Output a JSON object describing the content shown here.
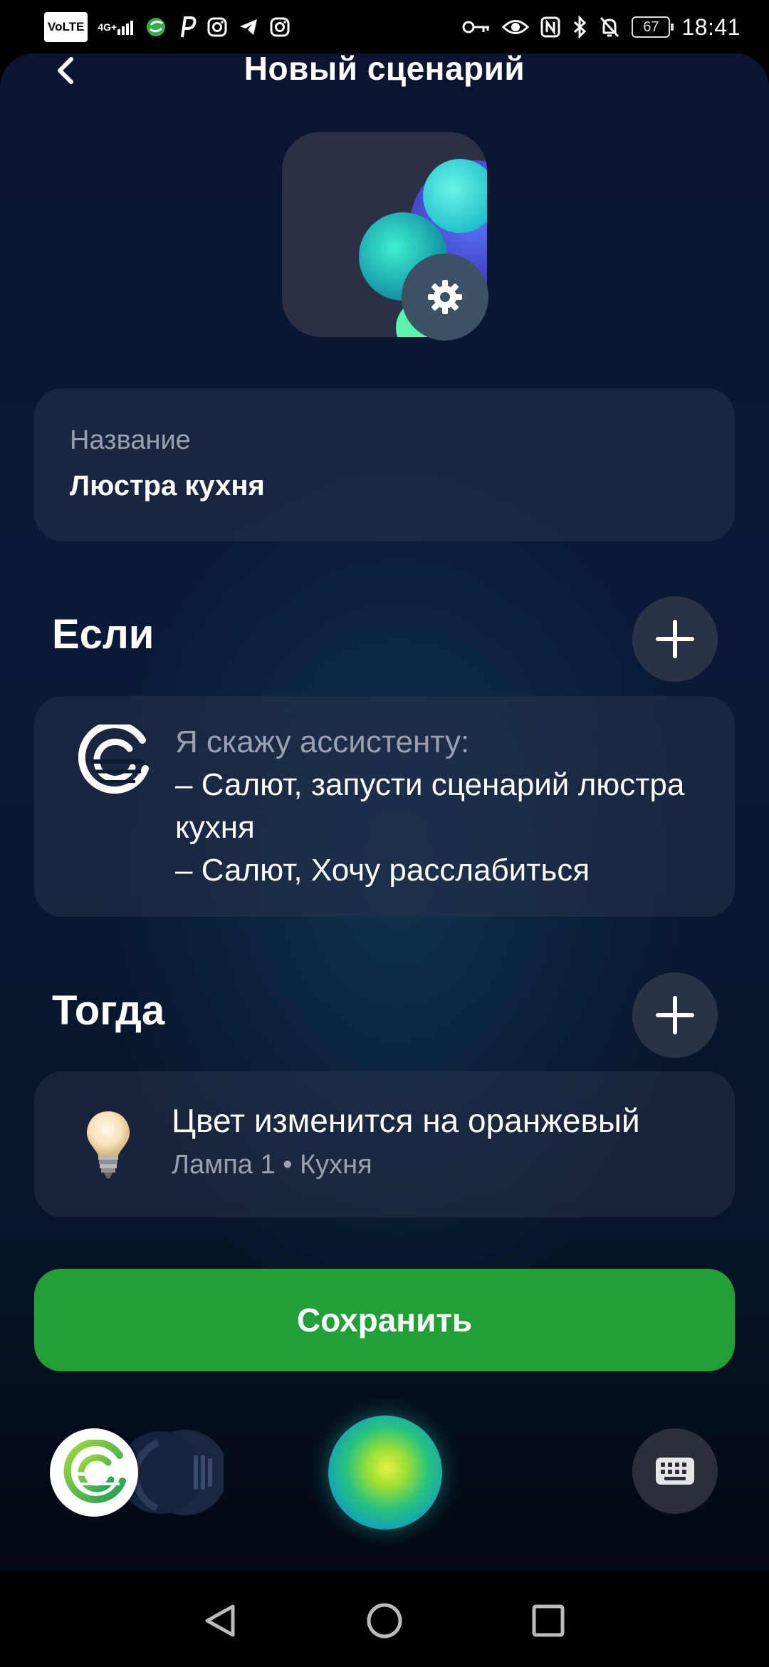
{
  "status_bar": {
    "left_icons": [
      "volte-icon",
      "signal-4g-icon",
      "salute-app-icon",
      "p-app-icon",
      "instagram-icon",
      "telegram-icon",
      "instagram-icon"
    ],
    "volte_label": "VoLTE",
    "network_label": "4G+",
    "right_icons": [
      "key-icon",
      "eye-icon",
      "nfc-icon",
      "bluetooth-icon",
      "mute-icon"
    ],
    "battery": "67",
    "time": "18:41"
  },
  "header": {
    "title": "Новый сценарий",
    "back_icon": "chevron-left-icon"
  },
  "cover": {
    "settings_icon": "gear-icon"
  },
  "name_field": {
    "label": "Название",
    "value": "Люстра кухня"
  },
  "if_section": {
    "title": "Если",
    "add_icon": "plus-icon",
    "condition": {
      "icon": "salute-logo-icon",
      "heading": "Я скажу ассистенту:",
      "phrases": [
        "– Салют, запусти сценарий люстра кухня",
        "– Салют, Хочу расслабиться"
      ]
    }
  },
  "then_section": {
    "title": "Тогда",
    "add_icon": "plus-icon",
    "action": {
      "icon": "lightbulb-icon",
      "title": "Цвет изменится на оранжевый",
      "subtitle": "Лампа 1 • Кухня"
    }
  },
  "save_button": {
    "label": "Сохранить",
    "color": "#21a038"
  },
  "assistant_bar": {
    "assistant_icon": "salute-assistant-icon",
    "orb_icon": "voice-orb-icon",
    "keyboard_icon": "keyboard-icon"
  },
  "nav_bar": {
    "icons": [
      "back-triangle-icon",
      "home-circle-icon",
      "recents-square-icon"
    ]
  },
  "colors": {
    "background": "#0a1a36",
    "card": "#1e2740",
    "accent_green": "#21a038",
    "secondary_text": "#9aa0ad"
  }
}
